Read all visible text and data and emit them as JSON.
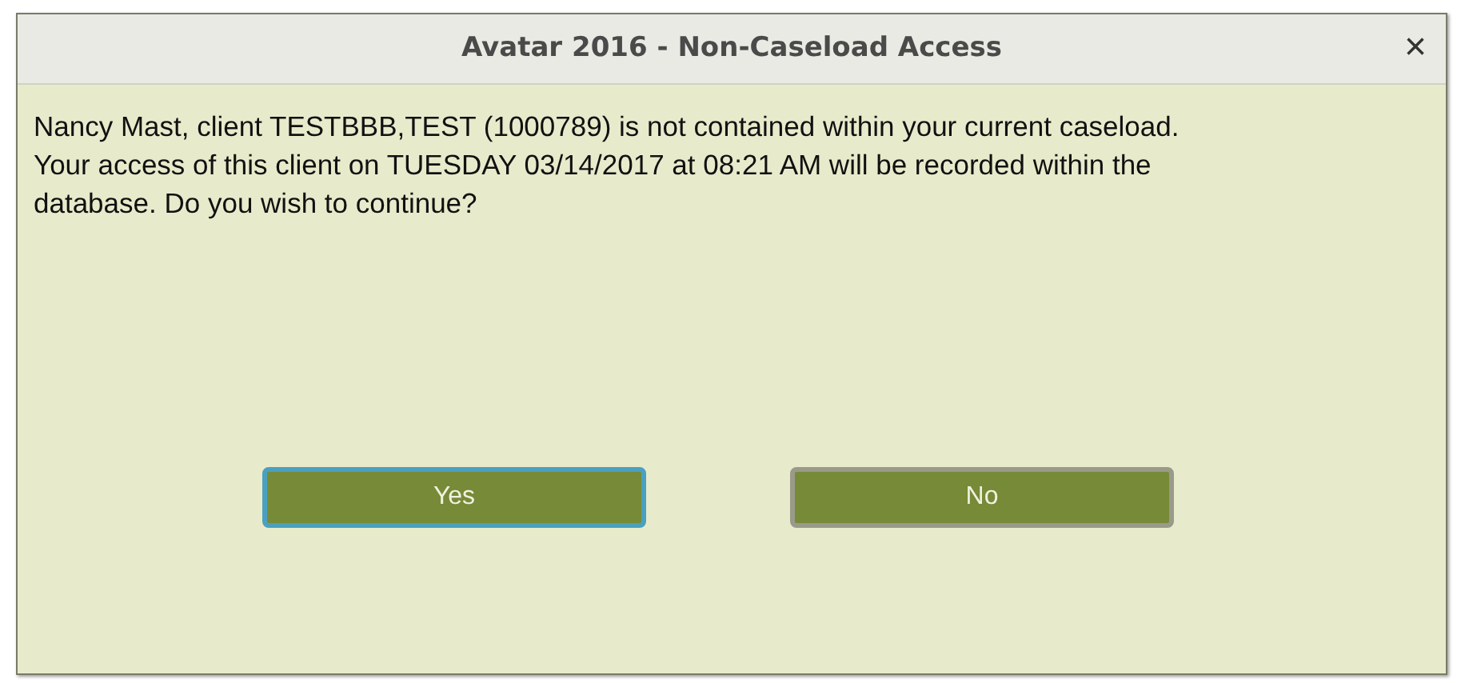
{
  "window": {
    "title": "Avatar 2016 - Non-Caseload Access",
    "close": "×"
  },
  "message": "Nancy Mast, client TESTBBB,TEST (1000789) is not contained within your current caseload. Your access of this client on TUESDAY 03/14/2017 at 08:21 AM will be recorded within the database. Do you wish to continue?",
  "buttons": [
    {
      "label": "Yes",
      "focused": true
    },
    {
      "label": "No",
      "focused": false
    }
  ]
}
